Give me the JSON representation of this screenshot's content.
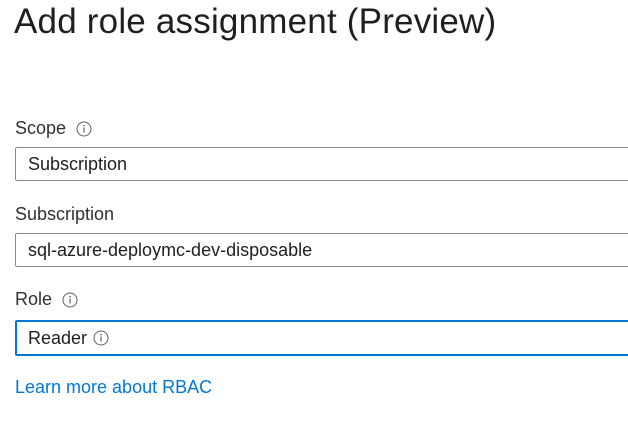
{
  "page": {
    "title": "Add role assignment (Preview)"
  },
  "scope": {
    "label": "Scope",
    "value": "Subscription",
    "info_icon": "info-icon"
  },
  "subscription": {
    "label": "Subscription",
    "value": "sql-azure-deploymc-dev-disposable"
  },
  "role": {
    "label": "Role",
    "value": "Reader",
    "info_icon": "info-icon",
    "value_info_icon": "info-icon"
  },
  "links": {
    "learn_more": "Learn more about RBAC"
  },
  "colors": {
    "accent": "#0078d4",
    "border": "#8a8886",
    "text": "#201f1e"
  }
}
